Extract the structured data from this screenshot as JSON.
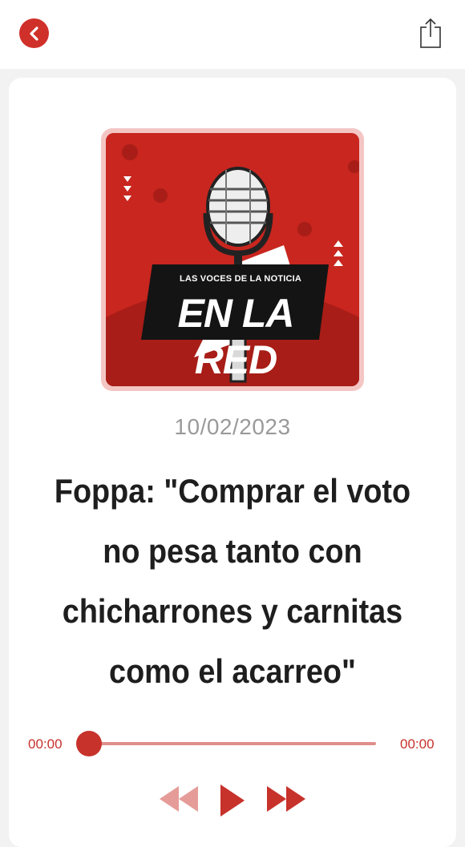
{
  "header": {
    "back_icon": "chevron-left-icon",
    "share_icon": "share-icon"
  },
  "podcast": {
    "cover_kicker": "LAS VOCES DE LA NOTICIA",
    "cover_title": "EN LA RED"
  },
  "episode": {
    "date": "10/02/2023",
    "title": "Foppa: \"Comprar el voto no pesa tanto con chicharrones y carnitas como el acarreo\""
  },
  "player": {
    "current_time": "00:00",
    "duration": "00:00",
    "progress": 0,
    "rewind_icon": "rewind-icon",
    "play_icon": "play-icon",
    "forward_icon": "fast-forward-icon"
  },
  "colors": {
    "accent": "#c7322b",
    "track": "#e08f8b",
    "rewind_disabled": "#e59c98"
  }
}
